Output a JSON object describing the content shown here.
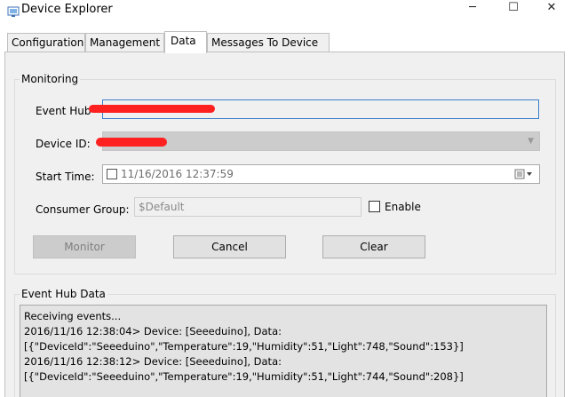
{
  "window": {
    "title": "Device Explorer",
    "controls": {
      "minimize": "─",
      "maximize": "☐",
      "close": "✕"
    }
  },
  "tabs": [
    {
      "label": "Configuration",
      "active": false
    },
    {
      "label": "Management",
      "active": false
    },
    {
      "label": "Data",
      "active": true
    },
    {
      "label": "Messages To Device",
      "active": false
    }
  ],
  "monitoring": {
    "title": "Monitoring",
    "event_hub_label": "Event Hub",
    "event_hub_value": "",
    "device_id_label": "Device ID:",
    "device_id_value": "",
    "start_time_label": "Start Time:",
    "start_time_value": "11/16/2016 12:37:59",
    "consumer_group_label": "Consumer Group:",
    "consumer_group_value": "$Default",
    "enable_label": "Enable",
    "enable_checked": false
  },
  "buttons": {
    "monitor": "Monitor",
    "cancel": "Cancel",
    "clear": "Clear"
  },
  "event_hub_data": {
    "title": "Event Hub Data",
    "lines": [
      "Receiving events...",
      "2016/11/16 12:38:04> Device: [Seeeduino], Data:",
      "[{\"DeviceId\":\"Seeeduino\",\"Temperature\":19,\"Humidity\":51,\"Light\":748,\"Sound\":153}]",
      "2016/11/16 12:38:12> Device: [Seeeduino], Data:",
      "[{\"DeviceId\":\"Seeeduino\",\"Temperature\":19,\"Humidity\":51,\"Light\":744,\"Sound\":208}]"
    ]
  },
  "colors": {
    "focus_border": "#3d7ec9",
    "redaction": "#ff2020",
    "panel_bg": "#f0f0f0"
  }
}
